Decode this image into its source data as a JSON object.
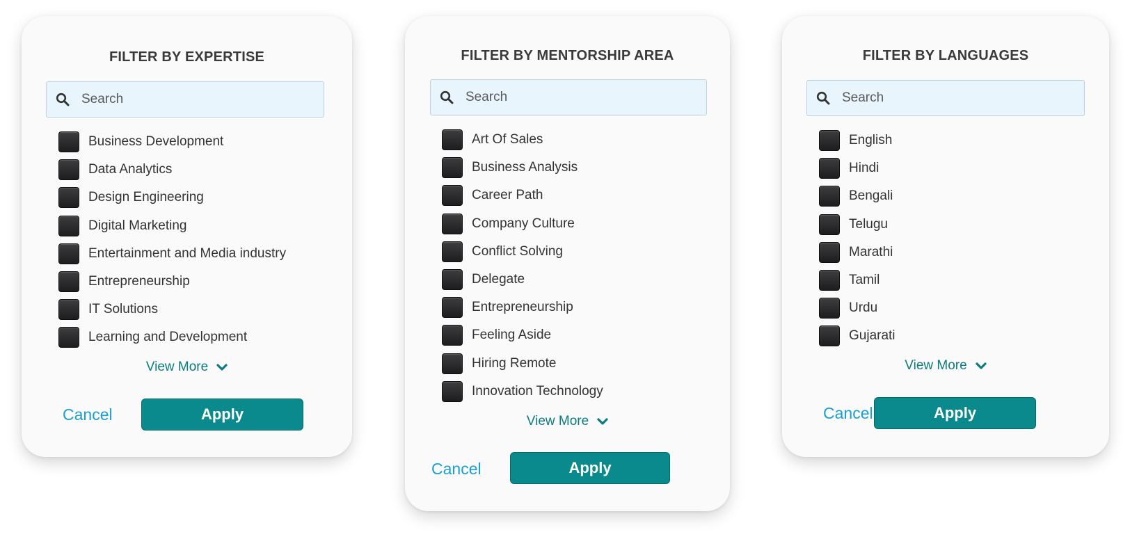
{
  "colors": {
    "accent": "#0a8a8c",
    "link": "#1a9fce",
    "view_more": "#0b7b7f",
    "search_bg": "#e8f5fc",
    "checkbox": "#2b2b2d"
  },
  "panels": [
    {
      "title": "FILTER BY EXPERTISE",
      "search_placeholder": "Search",
      "items": [
        "Business Development",
        "Data Analytics",
        "Design Engineering",
        "Digital Marketing",
        "Entertainment and Media industry",
        "Entrepreneurship",
        "IT Solutions",
        "Learning and Development"
      ],
      "view_more": "View More",
      "cancel": "Cancel",
      "apply": "Apply"
    },
    {
      "title": "FILTER BY MENTORSHIP AREA",
      "search_placeholder": "Search",
      "items": [
        "Art Of Sales",
        "Business Analysis",
        "Career Path",
        "Company Culture",
        "Conflict Solving",
        "Delegate",
        "Entrepreneurship",
        "Feeling Aside",
        "Hiring Remote",
        "Innovation Technology"
      ],
      "view_more": "View More",
      "cancel": "Cancel",
      "apply": "Apply"
    },
    {
      "title": "FILTER BY LANGUAGES",
      "search_placeholder": "Search",
      "items": [
        "English",
        "Hindi",
        "Bengali",
        "Telugu",
        "Marathi",
        "Tamil",
        "Urdu",
        "Gujarati"
      ],
      "view_more": "View More",
      "cancel": "Cancel",
      "apply": "Apply"
    }
  ]
}
